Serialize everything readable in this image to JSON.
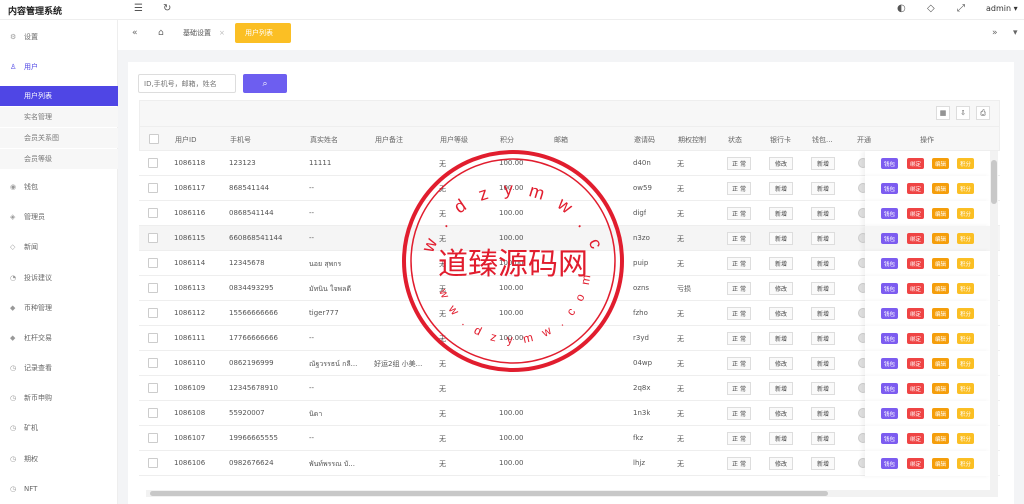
{
  "app": {
    "title": "内容管理系统",
    "user": "admin"
  },
  "sidebar": {
    "items": [
      {
        "label": "设置",
        "icon": "gear-icon"
      },
      {
        "label": "用户",
        "icon": "user-icon"
      },
      {
        "label": "钱包",
        "icon": "wallet-icon"
      },
      {
        "label": "管理员",
        "icon": "shield-icon"
      },
      {
        "label": "新闻",
        "icon": "tag-icon"
      },
      {
        "label": "投诉建议",
        "icon": "eye-icon"
      },
      {
        "label": "币种管理",
        "icon": "diamond-icon"
      },
      {
        "label": "杠杆交易",
        "icon": "diamond-icon"
      },
      {
        "label": "记录查看",
        "icon": "clock-icon"
      },
      {
        "label": "新币申购",
        "icon": "clock-icon"
      },
      {
        "label": "矿机",
        "icon": "clock-icon"
      },
      {
        "label": "期权",
        "icon": "clock-icon"
      },
      {
        "label": "NFT",
        "icon": "clock-icon"
      }
    ],
    "user_subitems": [
      "用户列表",
      "实名管理",
      "会员关系图",
      "会员等级"
    ]
  },
  "tabs": {
    "items": [
      "基础设置",
      "用户列表"
    ],
    "active": "用户列表"
  },
  "search": {
    "placeholder": "ID,手机号，邮箱，姓名"
  },
  "table": {
    "columns": [
      "用户ID",
      "手机号",
      "真实姓名",
      "用户备注",
      "用户等级",
      "积分",
      "邮箱",
      "邀请码",
      "期权控制",
      "状态",
      "银行卡",
      "钱包...",
      "开通",
      "操作"
    ],
    "rows": [
      {
        "id": "1086118",
        "phone": "123123",
        "name": "11111",
        "remark": "",
        "level": "无",
        "points": "100.00",
        "email": "",
        "invite": "d40n",
        "option": "无",
        "status": "正 常",
        "bank": "修改",
        "wallet": "新增"
      },
      {
        "id": "1086117",
        "phone": "868541144",
        "name": "--",
        "remark": "",
        "level": "无",
        "points": "100.00",
        "email": "",
        "invite": "ow59",
        "option": "无",
        "status": "正 常",
        "bank": "新增",
        "wallet": "新增"
      },
      {
        "id": "1086116",
        "phone": "0868541144",
        "name": "--",
        "remark": "",
        "level": "无",
        "points": "100.00",
        "email": "",
        "invite": "digf",
        "option": "无",
        "status": "正 常",
        "bank": "新增",
        "wallet": "新增"
      },
      {
        "id": "1086115",
        "phone": "660868541144",
        "name": "--",
        "remark": "",
        "level": "无",
        "points": "100.00",
        "email": "",
        "invite": "n3zo",
        "option": "无",
        "status": "正 常",
        "bank": "新增",
        "wallet": "新增"
      },
      {
        "id": "1086114",
        "phone": "12345678",
        "name": "นอย สุพกร",
        "remark": "",
        "level": "无",
        "points": "100.00",
        "email": "",
        "invite": "puip",
        "option": "无",
        "status": "正 常",
        "bank": "新增",
        "wallet": "新增"
      },
      {
        "id": "1086113",
        "phone": "0834493295",
        "name": "มัทนิน ใจพลดี",
        "remark": "",
        "level": "无",
        "points": "100.00",
        "email": "",
        "invite": "ozns",
        "option": "亏损",
        "status": "正 常",
        "bank": "修改",
        "wallet": "新增"
      },
      {
        "id": "1086112",
        "phone": "15566666666",
        "name": "tiger777",
        "remark": "",
        "level": "无",
        "points": "100.00",
        "email": "",
        "invite": "fzho",
        "option": "无",
        "status": "正 常",
        "bank": "修改",
        "wallet": "新增"
      },
      {
        "id": "1086111",
        "phone": "17766666666",
        "name": "--",
        "remark": "",
        "level": "无",
        "points": "100.00",
        "email": "",
        "invite": "r3yd",
        "option": "无",
        "status": "正 常",
        "bank": "新增",
        "wallet": "新增"
      },
      {
        "id": "1086110",
        "phone": "0862196999",
        "name": "ณัฐวรรธน์ กลี...",
        "remark": "好运2组 小美...",
        "level": "无",
        "points": "",
        "email": "",
        "invite": "04wp",
        "option": "无",
        "status": "正 常",
        "bank": "修改",
        "wallet": "新增"
      },
      {
        "id": "1086109",
        "phone": "12345678910",
        "name": "--",
        "remark": "",
        "level": "无",
        "points": "",
        "email": "",
        "invite": "2q8x",
        "option": "无",
        "status": "正 常",
        "bank": "新增",
        "wallet": "新增"
      },
      {
        "id": "1086108",
        "phone": "55920007",
        "name": "นิดา",
        "remark": "",
        "level": "无",
        "points": "100.00",
        "email": "",
        "invite": "1n3k",
        "option": "无",
        "status": "正 常",
        "bank": "修改",
        "wallet": "新增"
      },
      {
        "id": "1086107",
        "phone": "19966665555",
        "name": "--",
        "remark": "",
        "level": "无",
        "points": "100.00",
        "email": "",
        "invite": "fkz",
        "option": "无",
        "status": "正 常",
        "bank": "新增",
        "wallet": "新增"
      },
      {
        "id": "1086106",
        "phone": "0982676624",
        "name": "พันท์พรรณ บั...",
        "remark": "",
        "level": "无",
        "points": "100.00",
        "email": "",
        "invite": "lhjz",
        "option": "无",
        "status": "正 常",
        "bank": "修改",
        "wallet": "新增"
      }
    ],
    "actions": [
      "钱包",
      "绑定",
      "编辑",
      "积分"
    ]
  },
  "watermark": {
    "title": "道臻源码网",
    "url": "w w w . d z y m w . c o m"
  },
  "colors": {
    "accent": "#4f46e5",
    "tab_active": "#fbbf24",
    "stamp": "#e11d2e"
  }
}
